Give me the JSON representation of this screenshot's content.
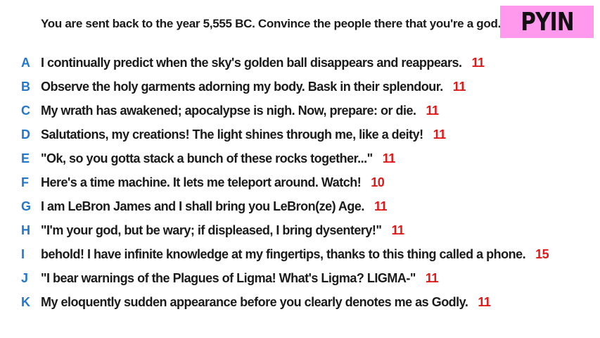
{
  "prompt": "You are sent back to the year 5,555 BC. Convince the people there that you're a god.",
  "badge": {
    "label": "PYIN",
    "color": "#ff99ee"
  },
  "colors": {
    "letter": "#2277cc",
    "score": "#e01818"
  },
  "answers": [
    {
      "letter": "A",
      "text": "I continually predict when the sky's golden ball disappears and reappears.",
      "score": "11"
    },
    {
      "letter": "B",
      "text": "Observe the holy garments adorning my body. Bask in their splendour.",
      "score": "11"
    },
    {
      "letter": "C",
      "text": "My wrath has awakened; apocalypse is nigh. Now, prepare: or die.",
      "score": "11"
    },
    {
      "letter": "D",
      "text": "Salutations, my creations! The light shines through me, like a deity!",
      "score": "11"
    },
    {
      "letter": "E",
      "text": "\"Ok, so you gotta stack a bunch of these rocks together...\"",
      "score": "11"
    },
    {
      "letter": "F",
      "text": "Here's a time machine. It lets me teleport around. Watch!",
      "score": "10"
    },
    {
      "letter": "G",
      "text": "I am LeBron James and I shall bring you LeBron(ze) Age.",
      "score": "11"
    },
    {
      "letter": "H",
      "text": "\"I'm your god, but be wary; if displeased, I bring dysentery!\"",
      "score": "11"
    },
    {
      "letter": "I",
      "text": "behold! I have infinite knowledge at my fingertips, thanks to this thing called a phone.",
      "score": "15"
    },
    {
      "letter": "J",
      "text": "\"I bear warnings of the Plagues of Ligma! What's Ligma? LIGMA-\"",
      "score": "11"
    },
    {
      "letter": "K",
      "text": "My eloquently sudden appearance before you clearly denotes me as Godly.",
      "score": "11"
    }
  ]
}
